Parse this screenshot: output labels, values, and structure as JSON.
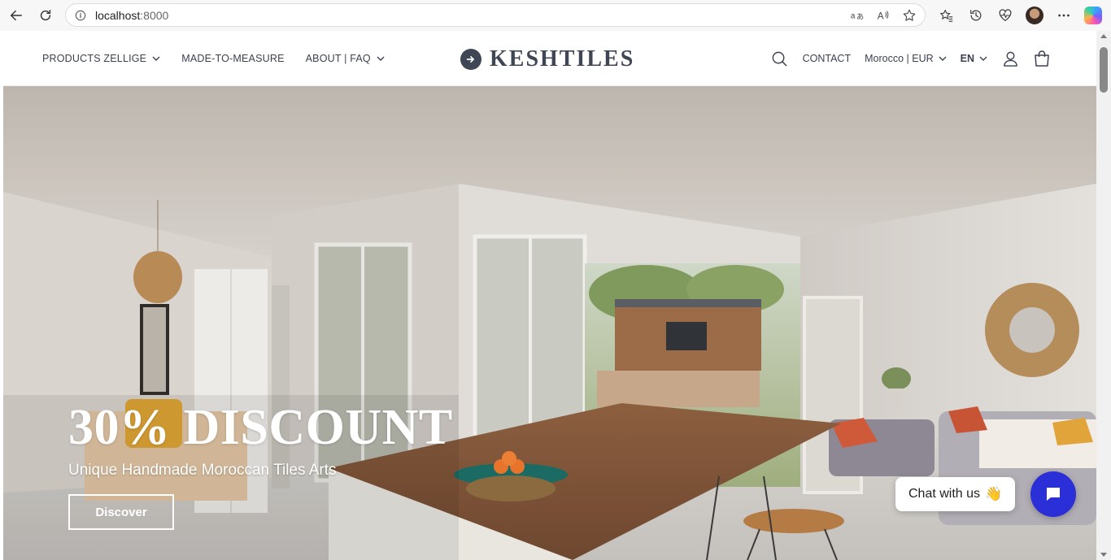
{
  "browser": {
    "url_host": "localhost",
    "url_port": ":8000",
    "translate_icon": "translate-icon",
    "read_aloud_icon": "read-aloud-icon",
    "favorite_icon": "star-icon"
  },
  "header": {
    "nav_left": [
      {
        "label": "PRODUCTS ZELLIGE",
        "has_dropdown": true
      },
      {
        "label": "MADE-TO-MEASURE",
        "has_dropdown": false
      },
      {
        "label": "ABOUT | FAQ",
        "has_dropdown": true
      }
    ],
    "logo_text": "KESHTILES",
    "contact_label": "CONTACT",
    "region_label": "Morocco | EUR",
    "language_label": "EN"
  },
  "hero": {
    "title": "30% DISCOUNT",
    "subtitle": "Unique Handmade Moroccan Tiles Arts",
    "cta_label": "Discover"
  },
  "chat": {
    "bubble_text": "Chat with us",
    "wave_emoji": "👋"
  },
  "colors": {
    "accent": "#2b2fd8",
    "logo": "#3f4654",
    "nav_text": "#3b4150"
  }
}
